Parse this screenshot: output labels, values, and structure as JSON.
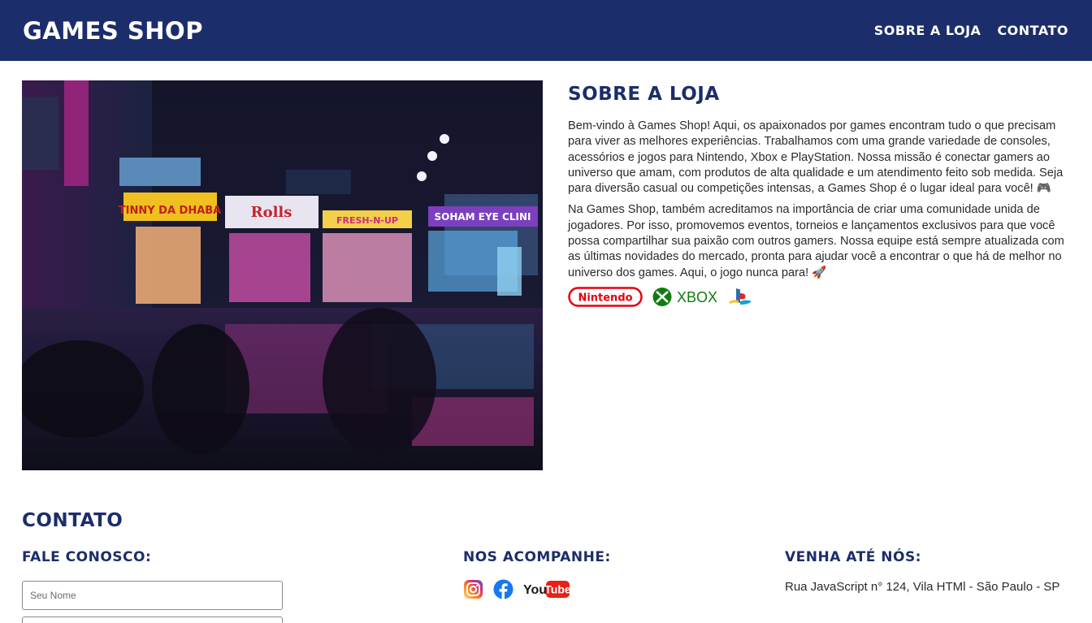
{
  "header": {
    "logo": "GAMES SHOP",
    "nav": [
      {
        "label": "SOBRE A LOJA"
      },
      {
        "label": "CONTATO"
      }
    ]
  },
  "about": {
    "title": "SOBRE A LOJA",
    "paragraph1": "Bem-vindo à Games Shop! Aqui, os apaixonados por games encontram tudo o que precisam para viver as melhores experiências. Trabalhamos com uma grande variedade de consoles, acessórios e jogos para Nintendo, Xbox e PlayStation. Nossa missão é conectar gamers ao universo que amam, com produtos de alta qualidade e um atendimento feito sob medida. Seja para diversão casual ou competições intensas, a Games Shop é o lugar ideal para você! 🎮",
    "paragraph2": "Na Games Shop, também acreditamos na importância de criar uma comunidade unida de jogadores. Por isso, promovemos eventos, torneios e lançamentos exclusivos para que você possa compartilhar sua paixão com outros gamers. Nossa equipe está sempre atualizada com as últimas novidades do mercado, pronta para ajudar você a encontrar o que há de melhor no universo dos games. Aqui, o jogo nunca para! 🚀",
    "brands": {
      "nintendo": "Nintendo",
      "xbox": "XBOX"
    }
  },
  "hero_signs": [
    "TINNY DA DHABA",
    "Rolls",
    "FRESH-N-UP",
    "SOHAM EYE CLINI"
  ],
  "contact": {
    "title": "CONTATO",
    "fale_title": "FALE CONOSCO:",
    "name_placeholder": "Seu Nome",
    "email_placeholder": "",
    "social_title": "NOS ACOMPANHE:",
    "social_icons": [
      "instagram-icon",
      "facebook-icon",
      "youtube-icon"
    ],
    "youtube_label": "You",
    "youtube_tube": "Tube",
    "visit_title": "VENHA ATÉ NÓS:",
    "address": "Rua JavaScript n° 124, Vila HTMl - São Paulo - SP"
  },
  "colors": {
    "primary": "#1c2d6b",
    "background": "#ffffff"
  }
}
